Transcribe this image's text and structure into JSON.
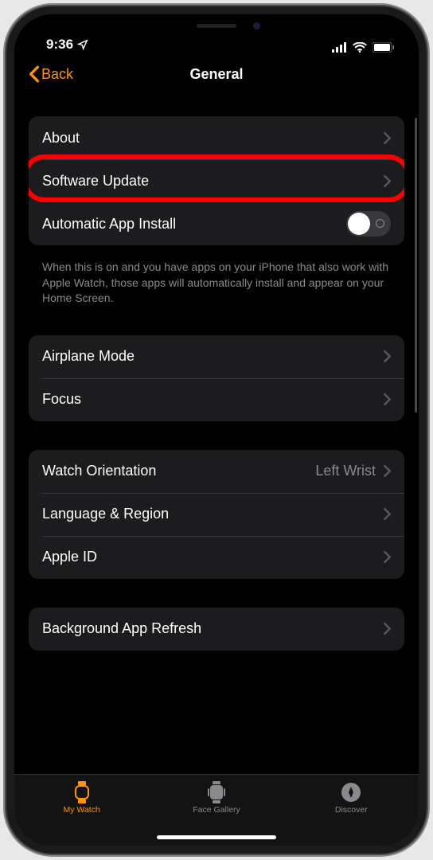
{
  "status": {
    "time": "9:36"
  },
  "nav": {
    "back": "Back",
    "title": "General"
  },
  "sections": [
    {
      "rows": [
        {
          "label": "About",
          "type": "disclosure"
        },
        {
          "label": "Software Update",
          "type": "disclosure",
          "highlighted": true
        },
        {
          "label": "Automatic App Install",
          "type": "toggle",
          "toggle_on": false
        }
      ],
      "footer": "When this is on and you have apps on your iPhone that also work with Apple Watch, those apps will automatically install and appear on your Home Screen."
    },
    {
      "rows": [
        {
          "label": "Airplane Mode",
          "type": "disclosure"
        },
        {
          "label": "Focus",
          "type": "disclosure"
        }
      ]
    },
    {
      "rows": [
        {
          "label": "Watch Orientation",
          "type": "disclosure",
          "value": "Left Wrist"
        },
        {
          "label": "Language & Region",
          "type": "disclosure"
        },
        {
          "label": "Apple ID",
          "type": "disclosure"
        }
      ]
    },
    {
      "rows": [
        {
          "label": "Background App Refresh",
          "type": "disclosure"
        }
      ]
    }
  ],
  "tabs": [
    {
      "label": "My Watch",
      "icon": "watch-icon",
      "active": true
    },
    {
      "label": "Face Gallery",
      "icon": "gallery-icon",
      "active": false
    },
    {
      "label": "Discover",
      "icon": "discover-icon",
      "active": false
    }
  ]
}
